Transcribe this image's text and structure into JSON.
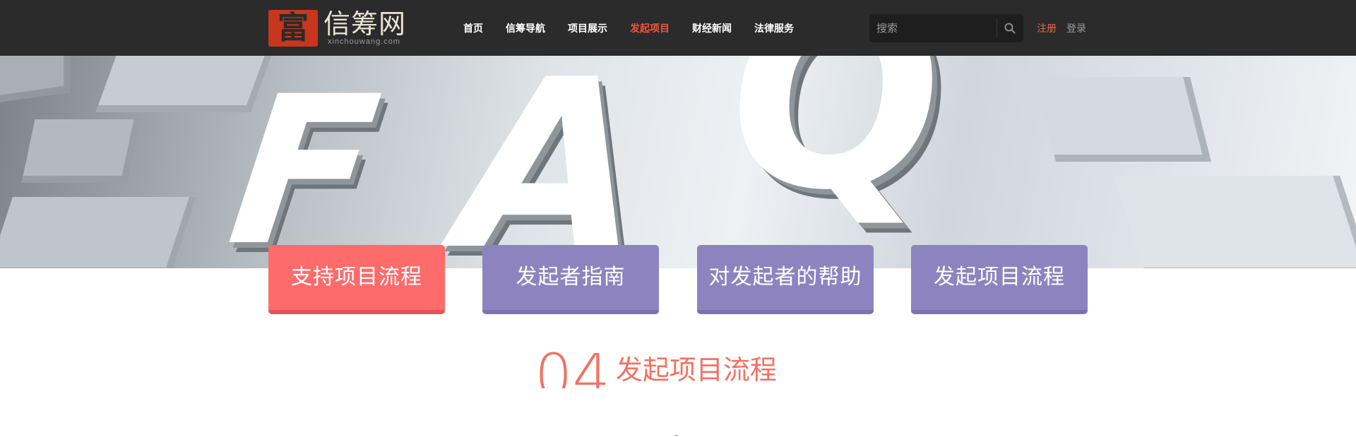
{
  "header": {
    "logo": {
      "glyph": "富",
      "name": "信筹网",
      "sub": "xinchouwang.com"
    },
    "nav": [
      {
        "label": "首页",
        "active": false
      },
      {
        "label": "信筹导航",
        "active": false
      },
      {
        "label": "项目展示",
        "active": false
      },
      {
        "label": "发起项目",
        "active": true
      },
      {
        "label": "财经新闻",
        "active": false
      },
      {
        "label": "法律服务",
        "active": false
      }
    ],
    "search": {
      "placeholder": "搜索",
      "icon": "search-icon"
    },
    "auth": {
      "register": "注册",
      "login": "登录"
    }
  },
  "banner": {
    "letters": [
      "F",
      "A",
      "Q"
    ]
  },
  "tabs": [
    {
      "label": "支持项目流程",
      "style": "red"
    },
    {
      "label": "发起者指南",
      "style": "purple"
    },
    {
      "label": "对发起者的帮助",
      "style": "purple"
    },
    {
      "label": "发起项目流程",
      "style": "purple"
    }
  ],
  "section": {
    "number": "04",
    "title": "发起项目流程"
  },
  "colors": {
    "header_bg": "#2b2b2b",
    "accent": "#f2543a",
    "tab_red": "#fd6b6b",
    "tab_purple": "#8d84bf",
    "section_color": "#f27262"
  }
}
